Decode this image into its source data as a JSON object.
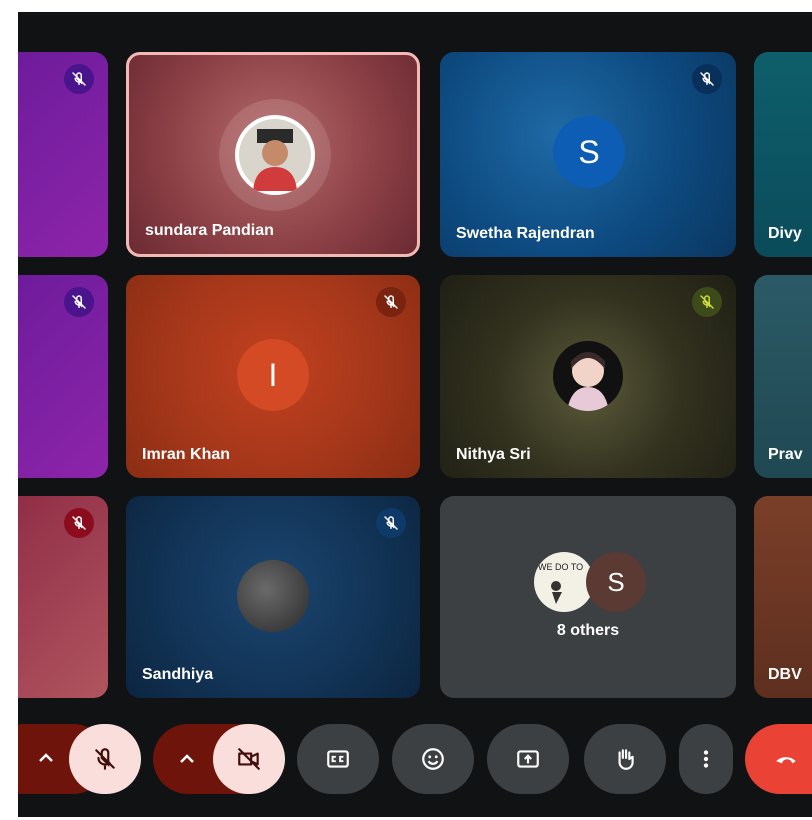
{
  "participants": [
    {
      "name": "sundara Pandian"
    },
    {
      "name": "Swetha Rajendran",
      "initial": "S"
    },
    {
      "name": "Divy"
    },
    {
      "name": "Imran Khan",
      "initial": "I"
    },
    {
      "name": "Nithya Sri"
    },
    {
      "name": "Prav"
    },
    {
      "name": "Sandhiya"
    },
    {
      "name": "DBV"
    }
  ],
  "others": {
    "count_label": "8 others",
    "avatar_initial": "S",
    "thumb_text": "WE DO TO"
  },
  "colors": {
    "background": "#111214",
    "control_bg": "#3c4043",
    "active_control": "#f9dedc",
    "end_call": "#ea4335",
    "tile_red": "#a83318",
    "tile_blue": "#0d3d66",
    "tile_purple": "#7b1fa2"
  },
  "controls": {
    "mic": {
      "state": "muted",
      "icon": "mic-off-icon"
    },
    "camera": {
      "state": "off",
      "icon": "videocam-off-icon"
    },
    "items": [
      "captions-icon",
      "emoji-icon",
      "present-icon",
      "raise-hand-icon",
      "more-icon",
      "end-call-icon"
    ]
  }
}
